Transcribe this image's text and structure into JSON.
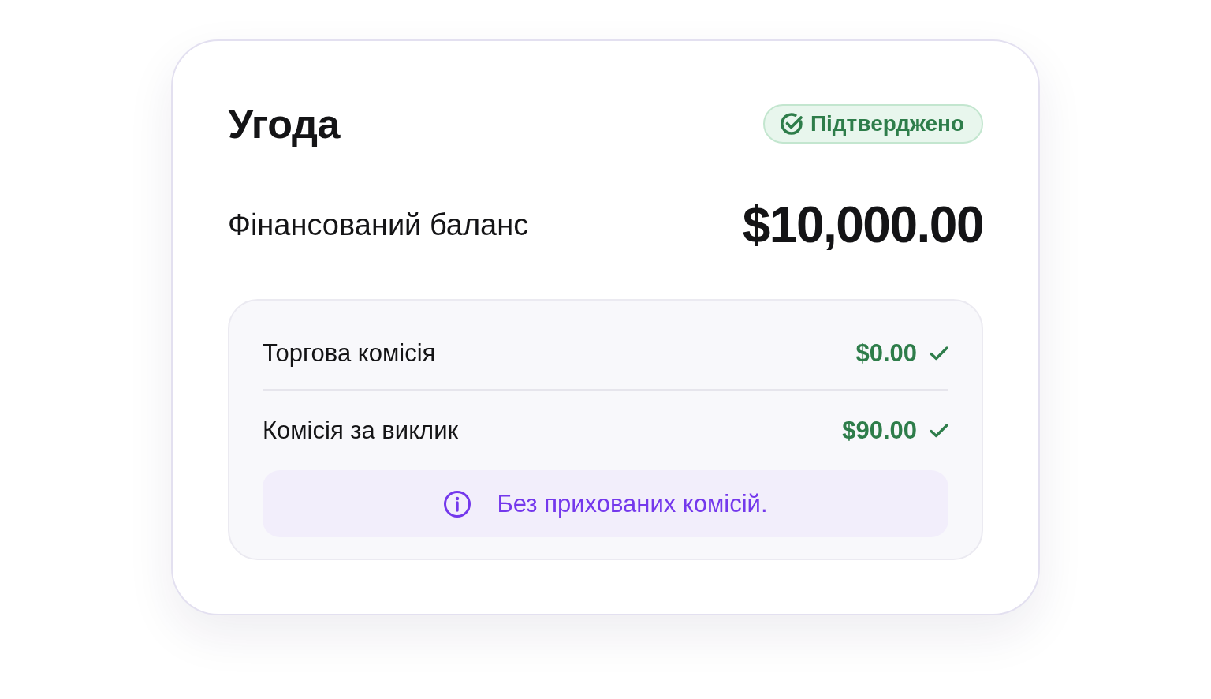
{
  "title": "Угода",
  "status_badge": {
    "label": "Підтверджено"
  },
  "balance": {
    "label": "Фінансований баланс",
    "amount": "$10,000.00"
  },
  "fees": [
    {
      "label": "Торгова комісія",
      "amount": "$0.00",
      "checked": true
    },
    {
      "label": "Комісія за виклик",
      "amount": "$90.00",
      "checked": true
    }
  ],
  "notice": {
    "text": "Без прихованих комісій."
  }
}
